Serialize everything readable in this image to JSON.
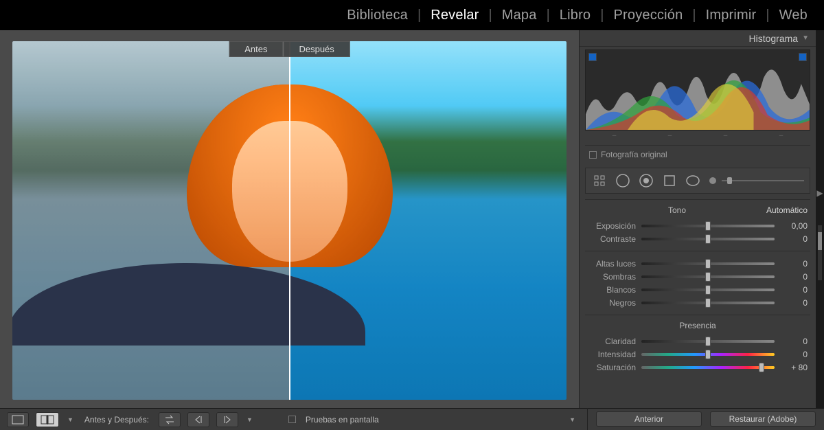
{
  "nav": {
    "items": [
      "Biblioteca",
      "Revelar",
      "Mapa",
      "Libro",
      "Proyección",
      "Imprimir",
      "Web"
    ],
    "active_index": 1
  },
  "compare": {
    "before_label": "Antes",
    "after_label": "Después"
  },
  "panel": {
    "histogram_title": "Histograma",
    "original_photo": "Fotografía original"
  },
  "tone": {
    "group_label": "Tono",
    "auto_label": "Automático",
    "sliders": [
      {
        "label": "Exposición",
        "value": "0,00",
        "pos": 50
      },
      {
        "label": "Contraste",
        "value": "0",
        "pos": 50
      }
    ]
  },
  "tone2": {
    "sliders": [
      {
        "label": "Altas luces",
        "value": "0",
        "pos": 50
      },
      {
        "label": "Sombras",
        "value": "0",
        "pos": 50
      },
      {
        "label": "Blancos",
        "value": "0",
        "pos": 50
      },
      {
        "label": "Negros",
        "value": "0",
        "pos": 50
      }
    ]
  },
  "presence": {
    "group_label": "Presencia",
    "sliders": [
      {
        "label": "Claridad",
        "value": "0",
        "pos": 50,
        "track": ""
      },
      {
        "label": "Intensidad",
        "value": "0",
        "pos": 50,
        "track": "color-sat"
      },
      {
        "label": "Saturación",
        "value": "+ 80",
        "pos": 90,
        "track": "color-sat"
      }
    ]
  },
  "bottom": {
    "compare_label": "Antes y Después:",
    "soft_proof": "Pruebas en pantalla",
    "prev_btn": "Anterior",
    "reset_btn": "Restaurar (Adobe)"
  }
}
